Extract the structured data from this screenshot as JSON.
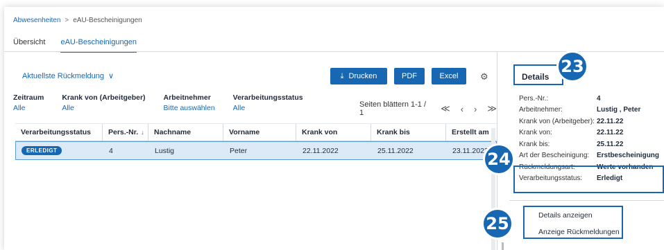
{
  "breadcrumb": {
    "parent": "Abwesenheiten",
    "separator": ">",
    "current": "eAU-Bescheinigungen"
  },
  "tabs": [
    {
      "label": "Übersicht"
    },
    {
      "label": "eAU-Bescheinigungen"
    }
  ],
  "toolbar": {
    "dropdown_label": "Aktuellste Rückmeldung",
    "print_label": "Drucken",
    "pdf_label": "PDF",
    "excel_label": "Excel"
  },
  "filters": [
    {
      "label": "Zeitraum",
      "value": "Alle"
    },
    {
      "label": "Krank von (Arbeitgeber)",
      "value": "Alle"
    },
    {
      "label": "Arbeitnehmer",
      "value": "Bitte auswählen"
    },
    {
      "label": "Verarbeitungsstatus",
      "value": "Alle"
    }
  ],
  "pager": {
    "text": "Seiten blättern 1-1 / 1"
  },
  "table": {
    "columns": [
      "Verarbeitungsstatus",
      "Pers.-Nr.",
      "Nachname",
      "Vorname",
      "Krank von",
      "Krank bis",
      "Erstellt am"
    ],
    "rows": [
      {
        "status": "ERLEDIGT",
        "pers_nr": "4",
        "nachname": "Lustig",
        "vorname": "Peter",
        "krank_von": "22.11.2022",
        "krank_bis": "25.11.2022",
        "erstellt_am": "23.11.2022"
      }
    ]
  },
  "details": {
    "title": "Details",
    "fields": [
      {
        "label": "Pers.-Nr.:",
        "value": "4"
      },
      {
        "label": "Arbeitnehmer:",
        "value": "Lustig , Peter"
      },
      {
        "label": "Krank von (Arbeitgeber):",
        "value": "22.11.22"
      },
      {
        "label": "Krank von:",
        "value": "22.11.22"
      },
      {
        "label": "Krank bis:",
        "value": "25.11.22"
      },
      {
        "label": "Art der Bescheinigung:",
        "value": "Erstbescheinigung"
      },
      {
        "label": "Rückmeldungsart:",
        "value": "Werte vorhanden"
      },
      {
        "label": "Verarbeitungsstatus:",
        "value": "Erledigt"
      }
    ],
    "actions": [
      {
        "label": "Details anzeigen"
      },
      {
        "label": "Anzeige Rückmeldungen"
      }
    ]
  },
  "markers": [
    "23",
    "24",
    "25"
  ],
  "colors": {
    "accent": "#1767b3",
    "row_selected": "#dbeaf6"
  },
  "icons": [
    "chevron-down-icon",
    "download-icon",
    "gear-icon",
    "sort-down-icon",
    "first-page-icon",
    "prev-page-icon",
    "next-page-icon",
    "last-page-icon"
  ]
}
